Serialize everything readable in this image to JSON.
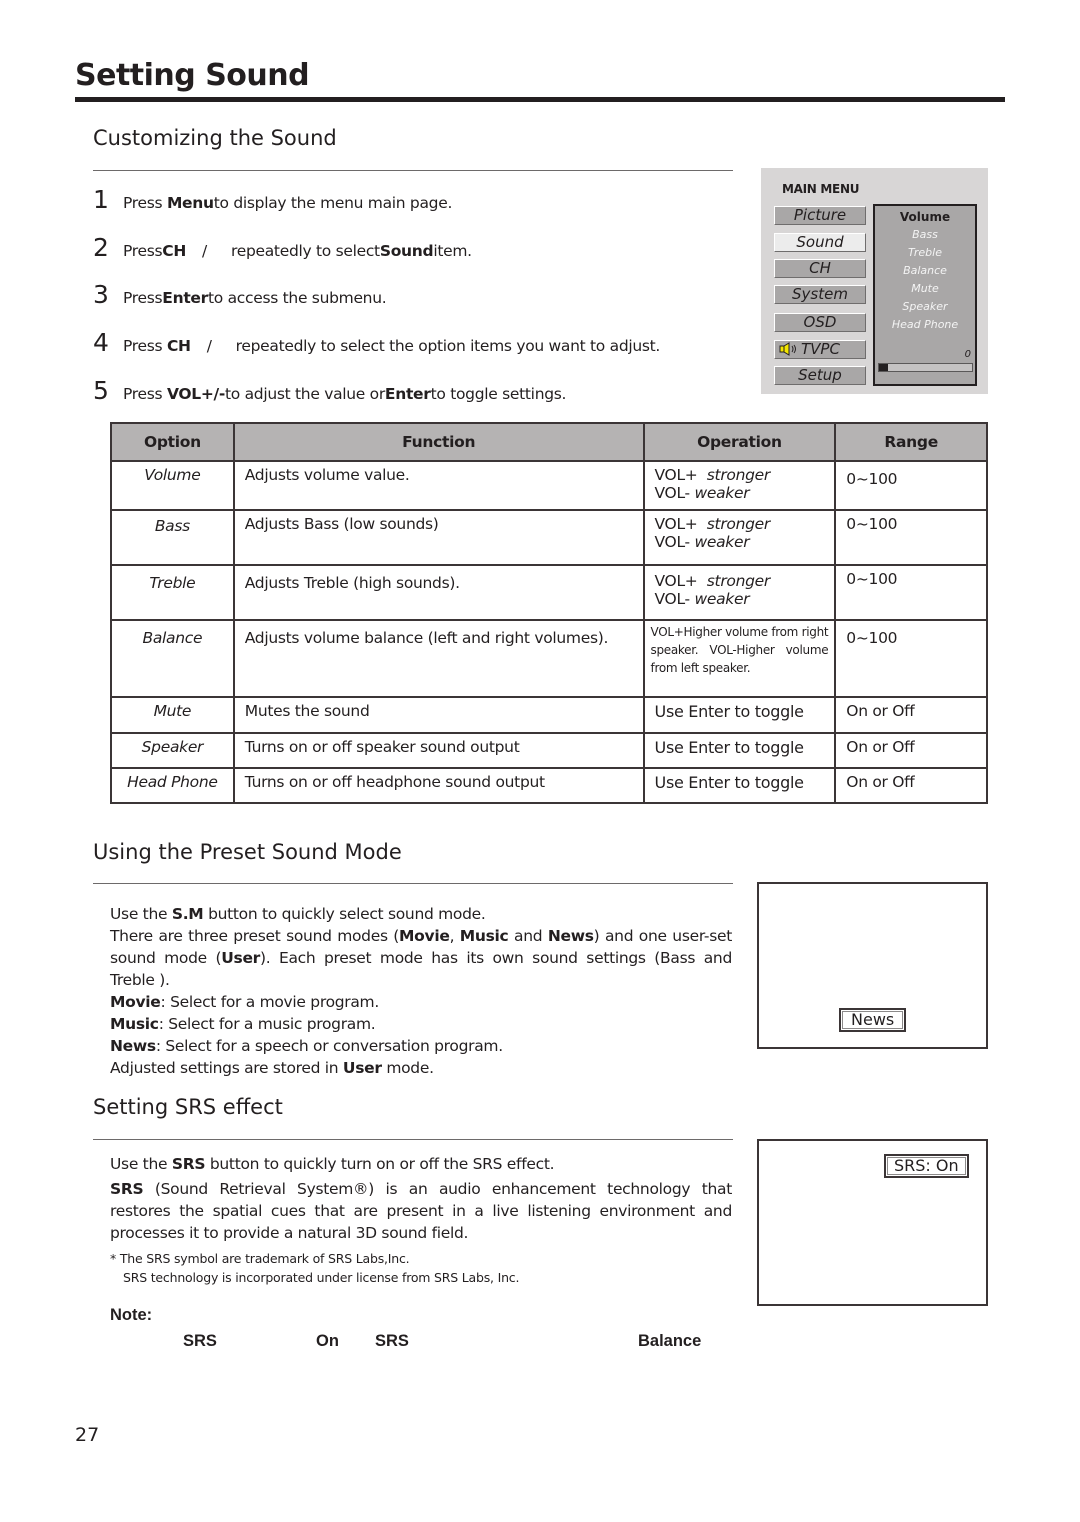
{
  "page": {
    "title": "Setting Sound",
    "page_number": "27"
  },
  "customizing": {
    "heading": "Customizing the Sound",
    "steps": [
      {
        "num": "1",
        "pre": "Press ",
        "key": "Menu",
        "post": " to display the menu main page."
      },
      {
        "num": "2",
        "pre": "Press ",
        "key": "CH",
        "sep": "/",
        "mid": "repeatedly to select ",
        "key2": "Sound",
        "post": " item."
      },
      {
        "num": "3",
        "pre": "Press ",
        "key": "Enter",
        "post": " to access the submenu."
      },
      {
        "num": "4",
        "pre": "Press ",
        "key": "CH",
        "sep": "/",
        "post": "repeatedly to select the option items you want to adjust."
      },
      {
        "num": "5",
        "pre": "Press ",
        "key": "VOL+/-",
        "mid": " to adjust the value  or ",
        "key2": "Enter",
        "post": " to toggle settings."
      }
    ]
  },
  "osd_menu": {
    "title": "MAIN MENU",
    "items": [
      "Picture",
      "Sound",
      "CH",
      "System",
      "OSD",
      "TVPC",
      "Setup"
    ],
    "active_item": "Sound",
    "speaker_icon_color": "#f3e600",
    "submenu": {
      "selected": "Volume",
      "items": [
        "Bass",
        "Treble",
        "Balance",
        "Mute",
        "Speaker",
        "Head Phone"
      ],
      "value": "0",
      "level_fraction": 0.0
    }
  },
  "options_table": {
    "headers": [
      "Option",
      "Function",
      "Operation",
      "Range"
    ],
    "rows": [
      {
        "option": "Volume",
        "function": "Adjusts volume value.",
        "op1": "VOL+",
        "op1_em": "stronger",
        "op2": "VOL-",
        "op2_em": "weaker",
        "range": "0~100"
      },
      {
        "option": "Bass",
        "function": "Adjusts Bass (low sounds)",
        "op1": "VOL+",
        "op1_em": "stronger",
        "op2": "VOL-",
        "op2_em": "weaker",
        "range": "0~100"
      },
      {
        "option": "Treble",
        "function": "Adjusts Treble (high sounds).",
        "op1": "VOL+",
        "op1_em": "stronger",
        "op2": "VOL-",
        "op2_em": "weaker",
        "range": "0~100"
      },
      {
        "option": "Balance",
        "function": "Adjusts volume balance (left and right volumes).",
        "op_text": "VOL+Higher volume from right speaker. VOL-Higher volume from left speaker.",
        "range": "0~100"
      },
      {
        "option": "Mute",
        "function": "Mutes the sound",
        "op_text": "Use Enter to toggle",
        "range": "On or Off"
      },
      {
        "option": "Speaker",
        "function": "Turns on or off speaker sound output",
        "op_text": "Use Enter to toggle",
        "range": "On or Off"
      },
      {
        "option": "Head Phone",
        "function": "Turns on or off headphone sound output",
        "op_text": "Use Enter to toggle",
        "range": "On or Off"
      }
    ]
  },
  "preset": {
    "heading": "Using the Preset Sound Mode",
    "line1_pre": "Use the ",
    "line1_key": "S.M",
    "line1_post": " button to quickly select sound mode.",
    "line2_a": "There are three preset sound modes (",
    "mode_movie": "Movie",
    "comma": ", ",
    "mode_music": "Music",
    "and": " and ",
    "mode_news": "News",
    "line2_b": ") and one user-set sound mode (",
    "mode_user": "User",
    "line2_c": "). Each preset mode has its own sound settings (Bass and Treble ).",
    "movie_desc": ": Select for a movie program.",
    "music_desc": ": Select for a music program.",
    "news_desc": ": Select for a speech or conversation program.",
    "stored_pre": "Adjusted settings are stored in ",
    "stored_post": " mode.",
    "screen_label": "News"
  },
  "srs": {
    "heading": "Setting SRS effect",
    "line1_pre": "Use the ",
    "line1_key": "SRS",
    "line1_post": " button to quickly turn on or off the SRS effect.",
    "desc_key": "SRS",
    "desc": " (Sound Retrieval System®) is an audio enhancement technology that restores the spatial cues that are present in a live listening environment and processes it to provide a natural 3D sound field.",
    "trademark1": "* The SRS symbol are trademark of SRS Labs,Inc.",
    "trademark2": "SRS technology is incorporated under license from SRS Labs, Inc.",
    "screen_label": "SRS:  On"
  },
  "note": {
    "label": "Note:",
    "words": [
      "SRS",
      "On",
      "SRS",
      "Balance"
    ]
  }
}
